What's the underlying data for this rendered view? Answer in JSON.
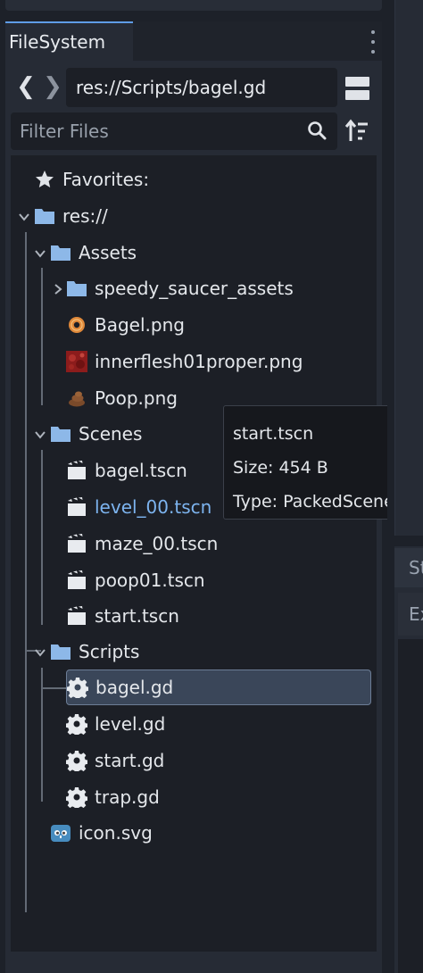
{
  "dock": {
    "tab_label": "FileSystem",
    "path": "res://Scripts/bagel.gd",
    "filter_placeholder": "Filter Files",
    "nav_prev_glyph": "❮",
    "nav_next_glyph": "❯"
  },
  "tree": {
    "favorites": "Favorites:",
    "root": "res://",
    "assets": {
      "label": "Assets",
      "items": [
        "speedy_saucer_assets",
        "Bagel.png",
        "innerflesh01proper.png",
        "Poop.png"
      ]
    },
    "scenes": {
      "label": "Scenes",
      "items": [
        "bagel.tscn",
        "level_00.tscn",
        "maze_00.tscn",
        "poop01.tscn",
        "start.tscn"
      ]
    },
    "scripts": {
      "label": "Scripts",
      "items": [
        "bagel.gd",
        "level.gd",
        "start.gd",
        "trap.gd"
      ]
    },
    "root_file": "icon.svg"
  },
  "tooltip": {
    "name": "start.tscn",
    "size": "Size: 454 B",
    "type": "Type: PackedScene"
  },
  "right_panel": {
    "tab1": "St",
    "tab2": "Ex"
  },
  "colors": {
    "accent": "#5f9ce6",
    "folder": "#8db8e8",
    "link": "#7db4ef",
    "selection": "#3a4659"
  },
  "icons": {
    "favorites": "star-icon",
    "folder": "folder-icon",
    "scene": "clapperboard-icon",
    "script": "gear-icon",
    "svg": "godot-logo-icon"
  }
}
